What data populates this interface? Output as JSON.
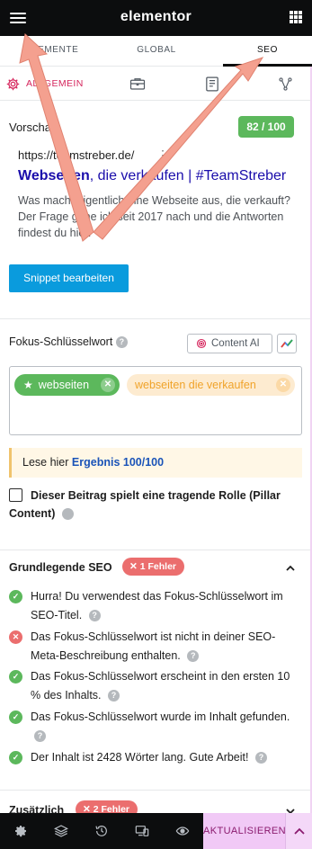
{
  "topbar": {
    "logo": "elementor",
    "menu_icon": "hamburger-menu-icon",
    "apps_icon": "grid-apps-icon"
  },
  "tabs": [
    {
      "label": "ELEMENTE"
    },
    {
      "label": "GLOBAL"
    },
    {
      "label": "SEO",
      "active": true
    }
  ],
  "subtabs": {
    "general_label": "ALLGEMEIN",
    "icons": [
      "gear-icon",
      "briefcase-icon",
      "document-icon",
      "share-graph-icon"
    ]
  },
  "preview": {
    "title": "Vorschau",
    "score": "82 / 100",
    "url": "https://teamstreber.de/",
    "serp_title_keyword": "Webseiten",
    "serp_title_rest": ", die verkaufen | #TeamStreber",
    "serp_description": "Was macht eigentlich eine Webseite aus, die verkauft? Der Frage gehe ich seit 2017 nach und die Antworten findest du hier.",
    "edit_button": "Snippet bearbeiten"
  },
  "focus_keyword": {
    "label": "Fokus-Schlüsselwort",
    "ai_button": "Content AI",
    "tags": [
      "webseiten",
      "webseiten die verkaufen"
    ]
  },
  "notice": {
    "prefix": "Lese hier ",
    "link": "Ergebnis 100/100"
  },
  "pillar": {
    "label": "Dieser Beitrag spielt eine tragende Rolle (Pillar Content)",
    "checked": false
  },
  "basic_seo": {
    "title": "Grundlegende SEO",
    "badge": "1 Fehler",
    "items": [
      {
        "status": "ok",
        "text": "Hurra! Du verwendest das Fokus-Schlüsselwort im SEO-Titel."
      },
      {
        "status": "error",
        "text": "Das Fokus-Schlüsselwort ist nicht in deiner SEO-Meta-Beschreibung enthalten."
      },
      {
        "status": "ok",
        "text": "Das Fokus-Schlüsselwort erscheint in den ersten 10 % des Inhalts."
      },
      {
        "status": "ok",
        "text": "Das Fokus-Schlüsselwort wurde im Inhalt gefunden."
      },
      {
        "status": "ok",
        "text": "Der Inhalt ist 2428 Wörter lang. Gute Arbeit!"
      }
    ]
  },
  "additional": {
    "title": "Zusätzlich",
    "badge": "2 Fehler"
  },
  "bottombar": {
    "icons": [
      "settings-icon",
      "layers-icon",
      "history-icon",
      "responsive-icon",
      "preview-eye-icon"
    ],
    "update_label": "AKTUALISIEREN"
  },
  "colors": {
    "accent_pink": "#d5255c",
    "success": "#5cb85c",
    "error": "#eb6e6e",
    "link_blue": "#1a0dab",
    "button_blue": "#0a9bdd"
  }
}
